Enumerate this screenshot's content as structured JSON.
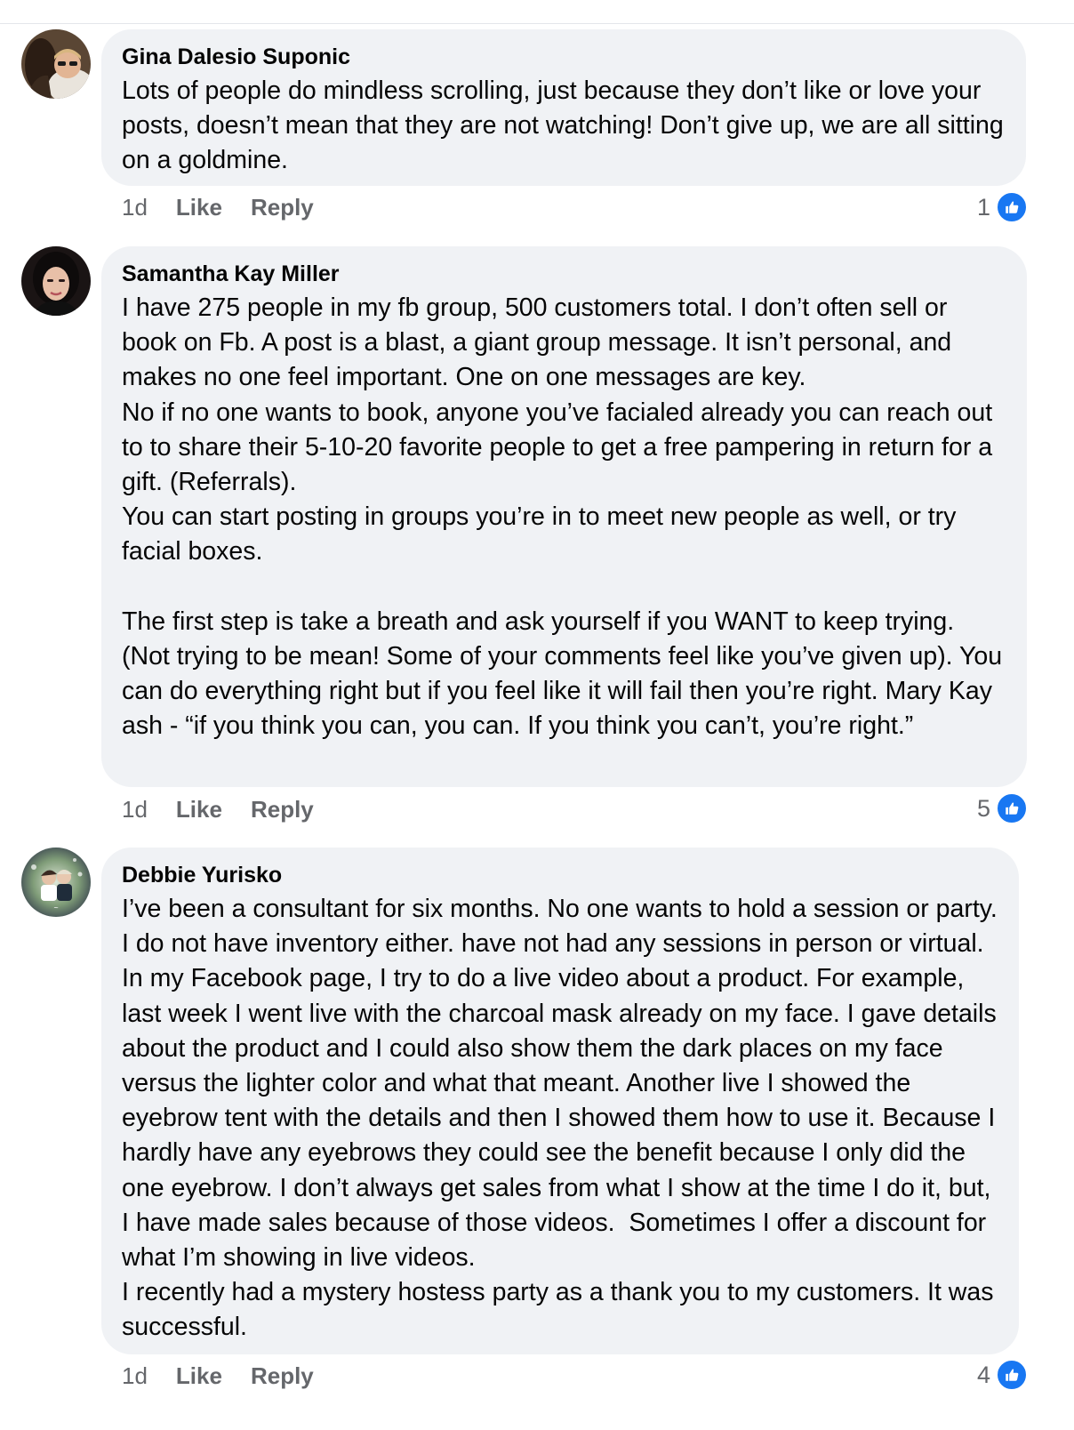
{
  "comments": [
    {
      "author": "Gina Dalesio Suponic",
      "avatar": "user-photo-avatar",
      "text": "Lots of people do mindless scrolling, just because they don’t like or love your posts, doesn’t mean that they are not watching! Don’t give up, we are all sitting on a goldmine.",
      "time": "1d",
      "like_label": "Like",
      "reply_label": "Reply",
      "reaction_count": "1",
      "reaction_icon": "like-thumb-icon"
    },
    {
      "author": "Samantha Kay Miller",
      "avatar": "user-photo-avatar",
      "text": "I have 275 people in my fb group, 500 customers total. I don’t often sell or book on Fb. A post is a blast, a giant group message. It isn’t personal, and makes no one feel important. One on one messages are key.\nNo if no one wants to book, anyone you’ve facialed already you can reach out to to share their 5-10-20 favorite people to get a free pampering in return for a gift. (Referrals).\nYou can start posting in groups you’re in to meet new people as well, or try facial boxes.\n\nThe first step is take a breath and ask yourself if you WANT to keep trying. (Not trying to be mean! Some of your comments feel like you’ve given up). You can do everything right but if you feel like it will fail then you’re right. Mary Kay ash - “if you think you can, you can. If you think you can’t, you’re right.”",
      "time": "1d",
      "like_label": "Like",
      "reply_label": "Reply",
      "reaction_count": "5",
      "reaction_icon": "like-thumb-icon"
    },
    {
      "author": "Debbie Yurisko",
      "avatar": "user-photo-avatar",
      "text": "I’ve been a consultant for six months. No one wants to hold a session or party. I do not have inventory either. have not had any sessions in person or virtual. In my Facebook page, I try to do a live video about a product. For example, last week I went live with the charcoal mask already on my face. I gave details about the product and I could also show them the dark places on my face versus the lighter color and what that meant. Another live I showed the eyebrow tent with the details and then I showed them how to use it. Because I hardly have any eyebrows they could see the benefit because I only did the one eyebrow. I don’t always get sales from what I show at the time I do it, but, I have made sales because of those videos.  Sometimes I offer a discount for what I’m showing in live videos.\nI recently had a mystery hostess party as a thank you to my customers. It was successful.",
      "time": "1d",
      "like_label": "Like",
      "reply_label": "Reply",
      "reaction_count": "4",
      "reaction_icon": "like-thumb-icon"
    }
  ],
  "colors": {
    "bubble": "#f0f2f5",
    "meta_text": "#65676b",
    "like_blue": "#1877f2"
  }
}
